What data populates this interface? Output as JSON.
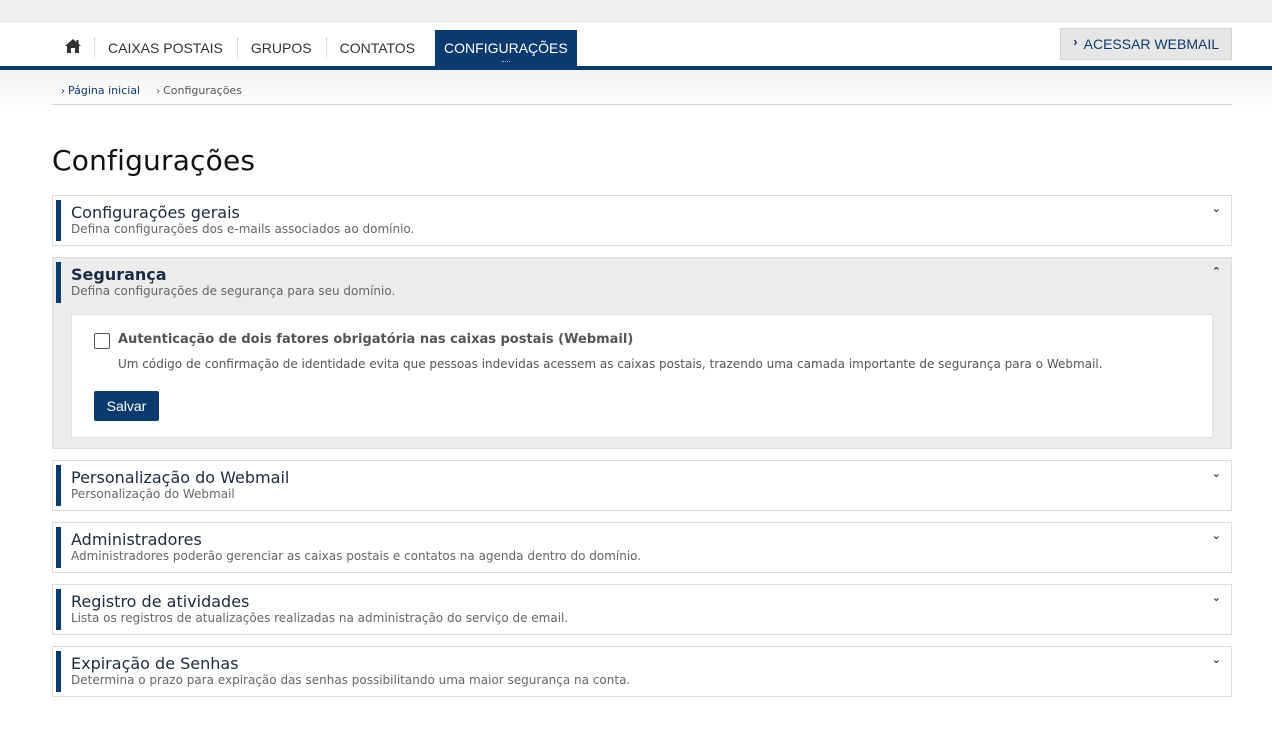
{
  "nav": {
    "home_icon": "home-icon",
    "items": [
      {
        "label": "CAIXAS POSTAIS"
      },
      {
        "label": "GRUPOS"
      },
      {
        "label": "CONTATOS"
      },
      {
        "label": "CONFIGURAÇÕES",
        "active": true
      }
    ],
    "webmail_label": "ACESSAR WEBMAIL",
    "accent": "#0b3a6e"
  },
  "breadcrumb": {
    "home": "Página inicial",
    "current": "Configurações"
  },
  "page_title": "Configurações",
  "panels": [
    {
      "title": "Configurações gerais",
      "desc": "Defina configurações dos e-mails associados ao domínio.",
      "state": "collapsed"
    },
    {
      "title": "Segurança",
      "desc": "Defina configurações de segurança para seu domínio.",
      "state": "expanded",
      "content": {
        "checkbox_label": "Autenticação de dois fatores obrigatória nas caixas postais (Webmail)",
        "checkbox_checked": false,
        "help": "Um código de confirmação de identidade evita que pessoas indevidas acessem as caixas postais, trazendo uma camada importante de segurança para o Webmail.",
        "save_label": "Salvar"
      }
    },
    {
      "title": "Personalização do Webmail",
      "desc": "Personalização do Webmail",
      "state": "collapsed"
    },
    {
      "title": "Administradores",
      "desc": "Administradores poderão gerenciar as caixas postais e contatos na agenda dentro do domínio.",
      "state": "collapsed"
    },
    {
      "title": "Registro de atividades",
      "desc": "Lista os registros de atualizações realizadas na administração do serviço de email.",
      "state": "collapsed"
    },
    {
      "title": "Expiração de Senhas",
      "desc": "Determina o prazo para expiração das senhas possibilitando uma maior segurança na conta.",
      "state": "collapsed"
    }
  ]
}
